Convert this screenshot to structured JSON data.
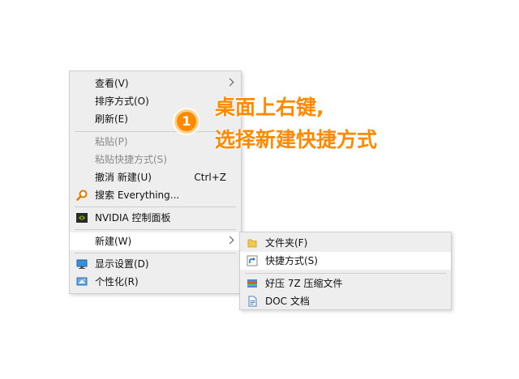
{
  "context_menu": {
    "items": [
      {
        "label": "查看(V)"
      },
      {
        "label": "排序方式(O)"
      },
      {
        "label": "刷新(E)"
      },
      {
        "label": "粘贴(P)"
      },
      {
        "label": "粘贴快捷方式(S)"
      },
      {
        "label": "撤消 新建(U)",
        "shortcut": "Ctrl+Z"
      },
      {
        "label": "搜索 Everything...",
        "icon": "magnifier-icon"
      },
      {
        "label": "NVIDIA 控制面板",
        "icon": "nvidia-icon"
      },
      {
        "label": "新建(W)"
      },
      {
        "label": "显示设置(D)",
        "icon": "display-icon"
      },
      {
        "label": "个性化(R)",
        "icon": "personalize-icon"
      }
    ]
  },
  "submenu": {
    "items": [
      {
        "label": "文件夹(F)",
        "icon": "folder-icon"
      },
      {
        "label": "快捷方式(S)",
        "icon": "shortcut-icon"
      },
      {
        "label": "好压 7Z 压缩文件",
        "icon": "archive-icon"
      },
      {
        "label": "DOC 文档",
        "icon": "doc-icon"
      }
    ]
  },
  "annotation": {
    "step": "1",
    "line1": "桌面上右键,",
    "line2": "选择新建快捷方式"
  },
  "colors": {
    "accent": "#ff8a00",
    "menu_bg": "#eeeeee",
    "highlight": "#ffffff",
    "disabled_text": "#8a8a8a"
  }
}
